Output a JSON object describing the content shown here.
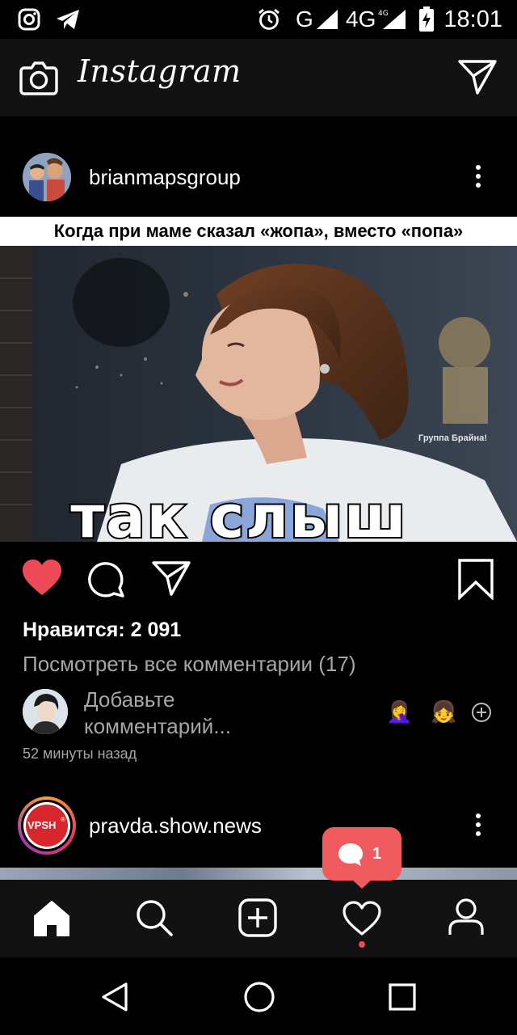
{
  "status_bar": {
    "time": "18:01",
    "network_label_1": "G",
    "network_label_2": "4G"
  },
  "app_bar": {
    "brand": "Instagram",
    "camera_icon": "camera-icon",
    "direct_icon": "paper-plane-icon"
  },
  "post1": {
    "username": "brianmapsgroup",
    "media_caption": "Когда при маме сказал «жопа», вместо «попа»",
    "media_subtitle": "так слыш",
    "watermark": "Группа Брайна!",
    "likes": "Нравится: 2 091",
    "view_comments": "Посмотреть все комментарии (17)",
    "add_comment_placeholder": "Добавьте комментарий...",
    "time_ago": "52 минуты назад",
    "emoji_1": "🤦‍♀️",
    "emoji_2": "👧",
    "liked": true
  },
  "post2": {
    "username": "pravda.show.news",
    "avatar_text": "VPSH",
    "avatar_reg": "®"
  },
  "notification": {
    "count": "1",
    "icon": "comment-bubble-icon"
  },
  "tab_bar": {
    "items": [
      "home-icon",
      "search-icon",
      "add-post-icon",
      "activity-heart-icon",
      "profile-icon"
    ],
    "active": "home-icon"
  },
  "colors": {
    "like_red": "#ed4956",
    "notification_red": "#ef5a5e",
    "secondary_text": "#a6a6a6",
    "bar_background": "#121212"
  }
}
